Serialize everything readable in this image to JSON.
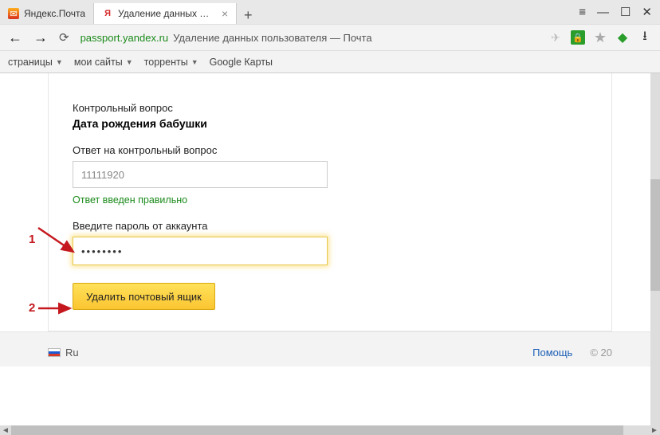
{
  "browser": {
    "tabs": [
      {
        "label": "Яндекс.Почта",
        "active": false
      },
      {
        "label": "Удаление данных польз",
        "active": true
      }
    ],
    "url_domain": "passport.yandex.ru",
    "url_path": "Удаление данных пользователя — Почта"
  },
  "bookmarks": {
    "items": [
      {
        "label": "страницы"
      },
      {
        "label": "мои сайты"
      },
      {
        "label": "торренты"
      },
      {
        "label": "Google Карты"
      }
    ]
  },
  "form": {
    "q_label": "Контрольный вопрос",
    "q_text": "Дата рождения бабушки",
    "answer_label": "Ответ на контрольный вопрос",
    "answer_value": "11111920",
    "answer_ok": "Ответ введен правильно",
    "password_label": "Введите пароль от аккаунта",
    "password_value": "••••••••",
    "submit_label": "Удалить почтовый ящик"
  },
  "footer": {
    "lang": "Ru",
    "help": "Помощь",
    "copy": "© 20"
  },
  "annotations": {
    "a1": "1",
    "a2": "2"
  }
}
